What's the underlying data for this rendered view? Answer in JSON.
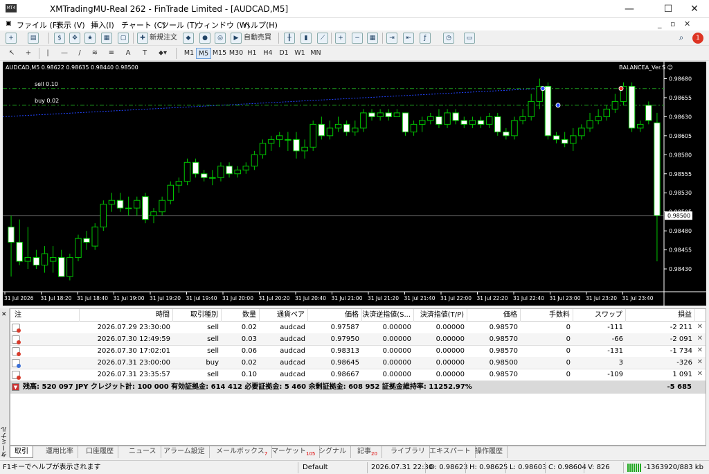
{
  "window": {
    "title": "XMTradingMU-Real 262 - FinTrade Limited - [AUDCAD,M5]",
    "icon": "MT4"
  },
  "menu": {
    "items": [
      "ファイル (F)",
      "表示 (V)",
      "挿入(I)",
      "チャート (C)",
      "ツール (T)",
      "ウィンドウ (W)",
      "ヘルプ(H)"
    ],
    "notification_count": "1"
  },
  "toolbar": {
    "new_order": "新規注文",
    "auto_trading": "自動売買",
    "timeframes": [
      "M1",
      "M5",
      "M15",
      "M30",
      "H1",
      "H4",
      "D1",
      "W1",
      "MN"
    ],
    "active_timeframe": "M5"
  },
  "chart": {
    "info": "AUDCAD,M5  0.98622 0.98635 0.98440 0.98500",
    "ea_name": "BALANCEA_Ver.S ☺",
    "sell_label": "sell 0.10",
    "buy_label": "buy 0.02",
    "current_price_label": "0.98500",
    "bull_color": "#00c800",
    "bear_color": "#ffffff",
    "level_color": "#1e9c1e"
  },
  "chart_data": {
    "type": "candlestick",
    "symbol": "AUDCAD",
    "timeframe": "M5",
    "ylim": [
      0.984,
      0.98695
    ],
    "y_ticks": [
      "0.98680",
      "0.98655",
      "0.98630",
      "0.98605",
      "0.98580",
      "0.98555",
      "0.98530",
      "0.98505",
      "0.98480",
      "0.98455",
      "0.98430"
    ],
    "x_ticks": [
      "31 Jul 2026",
      "31 Jul 18:20",
      "31 Jul 18:40",
      "31 Jul 19:00",
      "31 Jul 19:20",
      "31 Jul 19:40",
      "31 Jul 20:00",
      "31 Jul 20:20",
      "31 Jul 20:40",
      "31 Jul 21:00",
      "31 Jul 21:20",
      "31 Jul 21:40",
      "31 Jul 22:00",
      "31 Jul 22:20",
      "31 Jul 22:40",
      "31 Jul 23:00",
      "31 Jul 23:20",
      "31 Jul 23:40"
    ],
    "sell_level": 0.98667,
    "buy_level": 0.98645,
    "current_price": 0.985,
    "candles": [
      [
        0.98485,
        0.985,
        0.9842,
        0.98465
      ],
      [
        0.98465,
        0.98495,
        0.98435,
        0.9844
      ],
      [
        0.9844,
        0.98485,
        0.9843,
        0.98445
      ],
      [
        0.98445,
        0.98455,
        0.9843,
        0.98435
      ],
      [
        0.98435,
        0.9846,
        0.98425,
        0.9845
      ],
      [
        0.9844,
        0.9846,
        0.98425,
        0.98445
      ],
      [
        0.98445,
        0.98455,
        0.9842,
        0.9842
      ],
      [
        0.9842,
        0.9845,
        0.98415,
        0.98445
      ],
      [
        0.98445,
        0.98475,
        0.9844,
        0.9847
      ],
      [
        0.9847,
        0.9848,
        0.98455,
        0.98465
      ],
      [
        0.9846,
        0.9849,
        0.98455,
        0.98485
      ],
      [
        0.98485,
        0.9852,
        0.9848,
        0.98515
      ],
      [
        0.98515,
        0.9853,
        0.98505,
        0.9852
      ],
      [
        0.9852,
        0.9853,
        0.98505,
        0.9851
      ],
      [
        0.9851,
        0.98525,
        0.985,
        0.9851
      ],
      [
        0.9851,
        0.98525,
        0.985,
        0.9852
      ],
      [
        0.98525,
        0.9853,
        0.9849,
        0.98495
      ],
      [
        0.985,
        0.9851,
        0.9849,
        0.98505
      ],
      [
        0.98505,
        0.98525,
        0.985,
        0.9852
      ],
      [
        0.9852,
        0.98545,
        0.98515,
        0.9854
      ],
      [
        0.9854,
        0.9855,
        0.9853,
        0.98545
      ],
      [
        0.98545,
        0.98575,
        0.9854,
        0.9857
      ],
      [
        0.9857,
        0.98575,
        0.9855,
        0.98555
      ],
      [
        0.98555,
        0.9856,
        0.98545,
        0.9855
      ],
      [
        0.9855,
        0.9856,
        0.9854,
        0.9855
      ],
      [
        0.9855,
        0.9857,
        0.98545,
        0.98565
      ],
      [
        0.98565,
        0.9857,
        0.9855,
        0.98555
      ],
      [
        0.98555,
        0.98565,
        0.9855,
        0.9856
      ],
      [
        0.9856,
        0.9857,
        0.98555,
        0.98565
      ],
      [
        0.98565,
        0.98585,
        0.9856,
        0.9858
      ],
      [
        0.9858,
        0.986,
        0.98575,
        0.98595
      ],
      [
        0.98595,
        0.98605,
        0.98585,
        0.986
      ],
      [
        0.986,
        0.9861,
        0.9859,
        0.98605
      ],
      [
        0.986,
        0.9861,
        0.98585,
        0.986
      ],
      [
        0.986,
        0.9861,
        0.98575,
        0.98585
      ],
      [
        0.98585,
        0.986,
        0.98575,
        0.9859
      ],
      [
        0.9859,
        0.98625,
        0.98585,
        0.9862
      ],
      [
        0.9862,
        0.9863,
        0.986,
        0.98605
      ],
      [
        0.98605,
        0.98625,
        0.986,
        0.98615
      ],
      [
        0.98615,
        0.9863,
        0.9861,
        0.9862
      ],
      [
        0.9862,
        0.98625,
        0.98605,
        0.9861
      ],
      [
        0.9861,
        0.98625,
        0.98605,
        0.98615
      ],
      [
        0.98615,
        0.9864,
        0.9861,
        0.98635
      ],
      [
        0.98635,
        0.9864,
        0.98625,
        0.9863
      ],
      [
        0.9863,
        0.9864,
        0.98625,
        0.98635
      ],
      [
        0.98635,
        0.9864,
        0.98625,
        0.9863
      ],
      [
        0.9863,
        0.9864,
        0.9863,
        0.98635
      ],
      [
        0.98635,
        0.9863,
        0.98605,
        0.9861
      ],
      [
        0.9861,
        0.98625,
        0.98605,
        0.9862
      ],
      [
        0.9862,
        0.9863,
        0.9861,
        0.98625
      ],
      [
        0.98625,
        0.98635,
        0.9862,
        0.9863
      ],
      [
        0.9863,
        0.9864,
        0.98615,
        0.9862
      ],
      [
        0.9862,
        0.9864,
        0.98615,
        0.98635
      ],
      [
        0.98635,
        0.9864,
        0.9862,
        0.98625
      ],
      [
        0.98625,
        0.9863,
        0.98615,
        0.9862
      ],
      [
        0.9862,
        0.9863,
        0.98615,
        0.98625
      ],
      [
        0.98625,
        0.9863,
        0.98615,
        0.9862
      ],
      [
        0.9862,
        0.98635,
        0.98615,
        0.9863
      ],
      [
        0.9863,
        0.98635,
        0.98605,
        0.9861
      ],
      [
        0.9861,
        0.98615,
        0.986,
        0.98605
      ],
      [
        0.98605,
        0.9863,
        0.986,
        0.98625
      ],
      [
        0.98625,
        0.9864,
        0.9862,
        0.9863
      ],
      [
        0.9863,
        0.9866,
        0.98625,
        0.9865
      ],
      [
        0.9865,
        0.9868,
        0.9864,
        0.9867
      ],
      [
        0.9867,
        0.98675,
        0.986,
        0.98605
      ],
      [
        0.98605,
        0.9861,
        0.98595,
        0.986
      ],
      [
        0.986,
        0.9861,
        0.9859,
        0.98595
      ],
      [
        0.98595,
        0.98615,
        0.98585,
        0.98605
      ],
      [
        0.98605,
        0.9862,
        0.986,
        0.98615
      ],
      [
        0.98615,
        0.98635,
        0.9861,
        0.98625
      ],
      [
        0.98625,
        0.9864,
        0.9862,
        0.9863
      ],
      [
        0.9863,
        0.98645,
        0.98625,
        0.9864
      ],
      [
        0.9864,
        0.9866,
        0.98635,
        0.9865
      ],
      [
        0.9865,
        0.98675,
        0.98645,
        0.9867
      ],
      [
        0.9867,
        0.98675,
        0.9861,
        0.98615
      ],
      [
        0.98615,
        0.98625,
        0.9861,
        0.9862
      ],
      [
        0.98645,
        0.9865,
        0.9862,
        0.98625
      ],
      [
        0.98622,
        0.98635,
        0.9844,
        0.985
      ]
    ]
  },
  "terminal": {
    "side_label": "ターミナル",
    "headers": [
      "注",
      "時間",
      "取引種別",
      "数量",
      "通貨ペア",
      "価格",
      "決済逆指値(S...",
      "決済指値(T/P)",
      "価格",
      "手数料",
      "スワップ",
      "損益"
    ],
    "rows": [
      {
        "time": "2026.07.29 23:30:00",
        "type": "sell",
        "volume": "0.02",
        "symbol": "audcad",
        "price": "0.97587",
        "sl": "0.00000",
        "tp": "0.00000",
        "cur": "0.98570",
        "comm": "0",
        "swap": "-111",
        "profit": "-2 211",
        "kind": "sell"
      },
      {
        "time": "2026.07.30 12:49:59",
        "type": "sell",
        "volume": "0.03",
        "symbol": "audcad",
        "price": "0.97950",
        "sl": "0.00000",
        "tp": "0.00000",
        "cur": "0.98570",
        "comm": "0",
        "swap": "-66",
        "profit": "-2 091",
        "kind": "sell"
      },
      {
        "time": "2026.07.30 17:02:01",
        "type": "sell",
        "volume": "0.06",
        "symbol": "audcad",
        "price": "0.98313",
        "sl": "0.00000",
        "tp": "0.00000",
        "cur": "0.98570",
        "comm": "0",
        "swap": "-131",
        "profit": "-1 734",
        "kind": "sell"
      },
      {
        "time": "2026.07.31 23:00:00",
        "type": "buy",
        "volume": "0.02",
        "symbol": "audcad",
        "price": "0.98645",
        "sl": "0.00000",
        "tp": "0.00000",
        "cur": "0.98500",
        "comm": "0",
        "swap": "3",
        "profit": "-326",
        "kind": "buy"
      },
      {
        "time": "2026.07.31 23:35:57",
        "type": "sell",
        "volume": "0.10",
        "symbol": "audcad",
        "price": "0.98667",
        "sl": "0.00000",
        "tp": "0.00000",
        "cur": "0.98570",
        "comm": "0",
        "swap": "-109",
        "profit": "1 091",
        "kind": "sell"
      }
    ],
    "summary": "残高: 520 097 JPY  クレジット計: 100 000  有効証拠金: 614 412  必要証拠金: 5 460  余剰証拠金: 608 952  証拠金維持率: 11252.97%",
    "summary_total": "-5 685"
  },
  "tabs": [
    {
      "label": "取引",
      "badge": ""
    },
    {
      "label": "運用比率",
      "badge": ""
    },
    {
      "label": "口座履歴",
      "badge": ""
    },
    {
      "label": "ニュース",
      "badge": ""
    },
    {
      "label": "アラーム設定",
      "badge": ""
    },
    {
      "label": "メールボックス",
      "badge": "7"
    },
    {
      "label": "マーケット",
      "badge": "105"
    },
    {
      "label": "シグナル",
      "badge": ""
    },
    {
      "label": "記事",
      "badge": "20"
    },
    {
      "label": "ライブラリ",
      "badge": ""
    },
    {
      "label": "エキスパート",
      "badge": ""
    },
    {
      "label": "操作履歴",
      "badge": ""
    }
  ],
  "status": {
    "help": "F1キーでヘルプが表示されます",
    "profile": "Default",
    "datetime": "2026.07.31 22:30",
    "open": "O: 0.98623",
    "high": "H: 0.98625",
    "low": "L: 0.98603",
    "close": "C: 0.98604",
    "volume": "V: 826",
    "traffic": "-1363920/883 kb"
  }
}
